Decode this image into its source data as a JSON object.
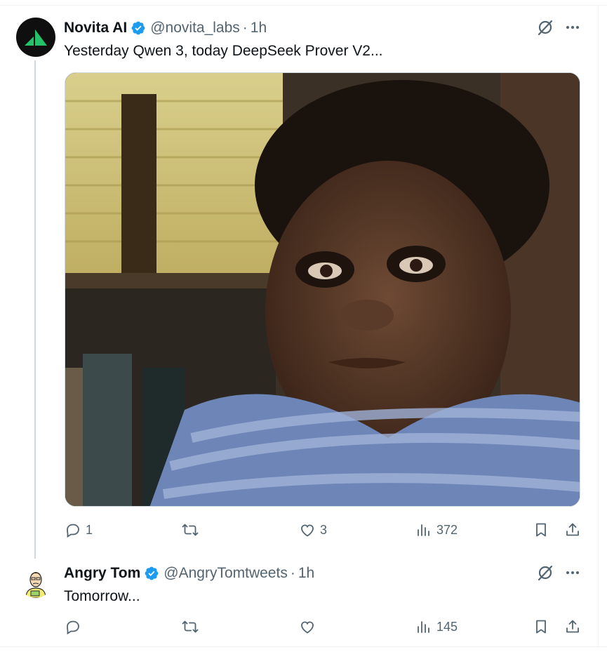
{
  "tweets": [
    {
      "name": "Novita AI",
      "handle": "@novita_labs",
      "dot": "·",
      "time": "1h",
      "text": "Yesterday Qwen 3, today DeepSeek Prover V2...",
      "actions": {
        "replies": "1",
        "reposts": "",
        "likes": "3",
        "views": "372"
      }
    },
    {
      "name": "Angry Tom",
      "handle": "@AngryTomtweets",
      "dot": "·",
      "time": "1h",
      "text": "Tomorrow...",
      "actions": {
        "replies": "",
        "reposts": "",
        "likes": "",
        "views": "145"
      }
    }
  ],
  "colors": {
    "accent": "#1d9bf0",
    "text_primary": "#0f1419",
    "text_secondary": "#536471",
    "brand_green": "#23c26b"
  },
  "icons": [
    "verified-badge-icon",
    "grok-icon",
    "more-icon",
    "reply-icon",
    "repost-icon",
    "like-icon",
    "views-icon",
    "bookmark-icon",
    "share-icon"
  ]
}
